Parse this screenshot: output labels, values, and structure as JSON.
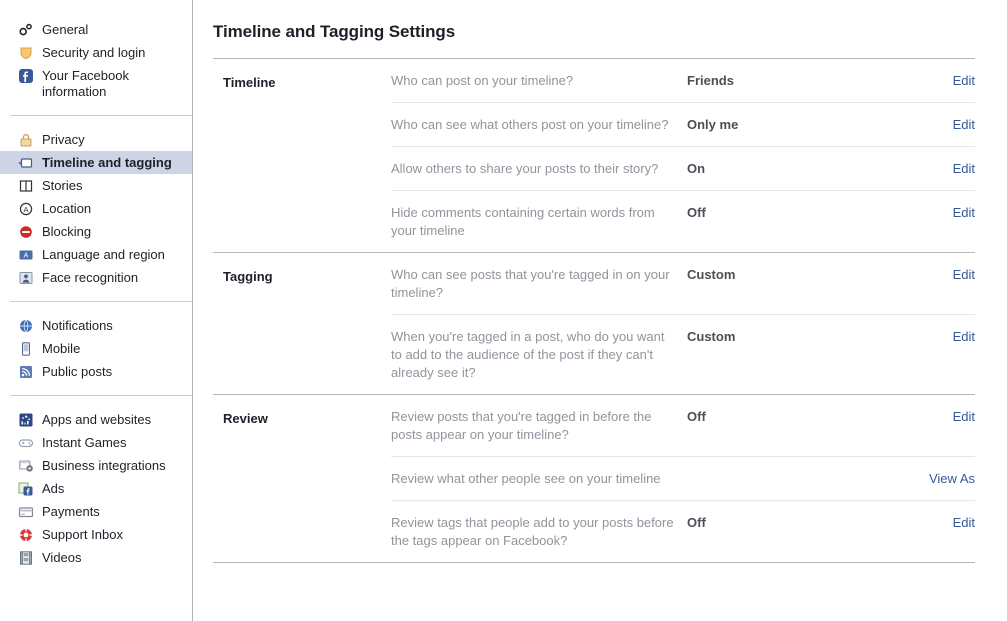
{
  "sidebar": {
    "groups": [
      {
        "items": [
          {
            "label": "General",
            "icon": "gears-icon",
            "selected": false
          },
          {
            "label": "Security and login",
            "icon": "shield-icon",
            "selected": false
          },
          {
            "label": "Your Facebook information",
            "icon": "facebook-icon",
            "selected": false,
            "wrap": true
          }
        ]
      },
      {
        "items": [
          {
            "label": "Privacy",
            "icon": "lock-icon",
            "selected": false
          },
          {
            "label": "Timeline and tagging",
            "icon": "timeline-icon",
            "selected": true
          },
          {
            "label": "Stories",
            "icon": "book-icon",
            "selected": false
          },
          {
            "label": "Location",
            "icon": "location-icon",
            "selected": false
          },
          {
            "label": "Blocking",
            "icon": "block-icon",
            "selected": false
          },
          {
            "label": "Language and region",
            "icon": "language-icon",
            "selected": false
          },
          {
            "label": "Face recognition",
            "icon": "face-icon",
            "selected": false
          }
        ]
      },
      {
        "items": [
          {
            "label": "Notifications",
            "icon": "globe-icon",
            "selected": false
          },
          {
            "label": "Mobile",
            "icon": "mobile-icon",
            "selected": false
          },
          {
            "label": "Public posts",
            "icon": "rss-icon",
            "selected": false
          }
        ]
      },
      {
        "items": [
          {
            "label": "Apps and websites",
            "icon": "apps-icon",
            "selected": false
          },
          {
            "label": "Instant Games",
            "icon": "gamepad-icon",
            "selected": false
          },
          {
            "label": "Business integrations",
            "icon": "business-gear-icon",
            "selected": false
          },
          {
            "label": "Ads",
            "icon": "ads-icon",
            "selected": false
          },
          {
            "label": "Payments",
            "icon": "card-icon",
            "selected": false
          },
          {
            "label": "Support Inbox",
            "icon": "lifering-icon",
            "selected": false
          },
          {
            "label": "Videos",
            "icon": "film-icon",
            "selected": false
          }
        ]
      }
    ]
  },
  "main": {
    "title": "Timeline and Tagging Settings",
    "sections": [
      {
        "label": "Timeline",
        "rows": [
          {
            "question": "Who can post on your timeline?",
            "value": "Friends",
            "action": "Edit"
          },
          {
            "question": "Who can see what others post on your timeline?",
            "value": "Only me",
            "action": "Edit"
          },
          {
            "question": "Allow others to share your posts to their story?",
            "value": "On",
            "action": "Edit"
          },
          {
            "question": "Hide comments containing certain words from your timeline",
            "value": "Off",
            "action": "Edit"
          }
        ]
      },
      {
        "label": "Tagging",
        "rows": [
          {
            "question": "Who can see posts that you're tagged in on your timeline?",
            "value": "Custom",
            "action": "Edit"
          },
          {
            "question": "When you're tagged in a post, who do you want to add to the audience of the post if they can't already see it?",
            "value": "Custom",
            "action": "Edit"
          }
        ]
      },
      {
        "label": "Review",
        "rows": [
          {
            "question": "Review posts that you're tagged in before the posts appear on your timeline?",
            "value": "Off",
            "action": "Edit"
          },
          {
            "question": "Review what other people see on your timeline",
            "value": "",
            "action": "View As"
          },
          {
            "question": "Review tags that people add to your posts before the tags appear on Facebook?",
            "value": "Off",
            "action": "Edit"
          }
        ]
      }
    ]
  },
  "colors": {
    "link": "#365899",
    "selected_bg": "#ccd4e5",
    "question_text": "#90949c",
    "value_text": "#4b4f56",
    "title_text": "#1d2129"
  }
}
